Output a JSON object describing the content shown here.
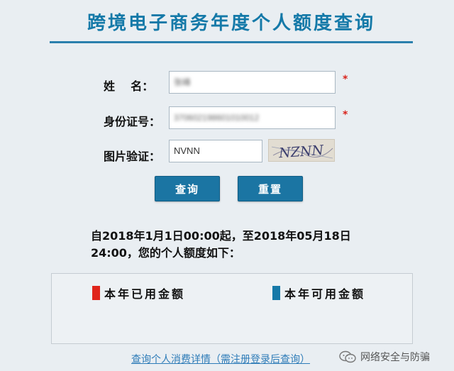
{
  "page": {
    "title": "跨境电子商务年度个人额度查询"
  },
  "form": {
    "name_label": "姓    名：",
    "name_value": "张峰",
    "id_label": "身份证号：",
    "id_value": "370602198601010012",
    "captcha_label": "图片验证：",
    "captcha_value": "NVNN",
    "captcha_image_text": "NZNN",
    "required_mark": "*"
  },
  "buttons": {
    "query": "查询",
    "reset": "重置"
  },
  "notice": {
    "line1": "自2018年1月1日00:00起，至2018年05月18日",
    "line2": "24:00，您的个人额度如下："
  },
  "legend": {
    "used": {
      "label": "本年已用金额",
      "color": "#e0251b"
    },
    "available": {
      "label": "本年可用金额",
      "color": "#1679a8"
    }
  },
  "links": {
    "details": "查询个人消费详情（需注册登录后查询）"
  },
  "watermark": {
    "text": "网络安全与防骗",
    "icon": "wechat-icon"
  }
}
